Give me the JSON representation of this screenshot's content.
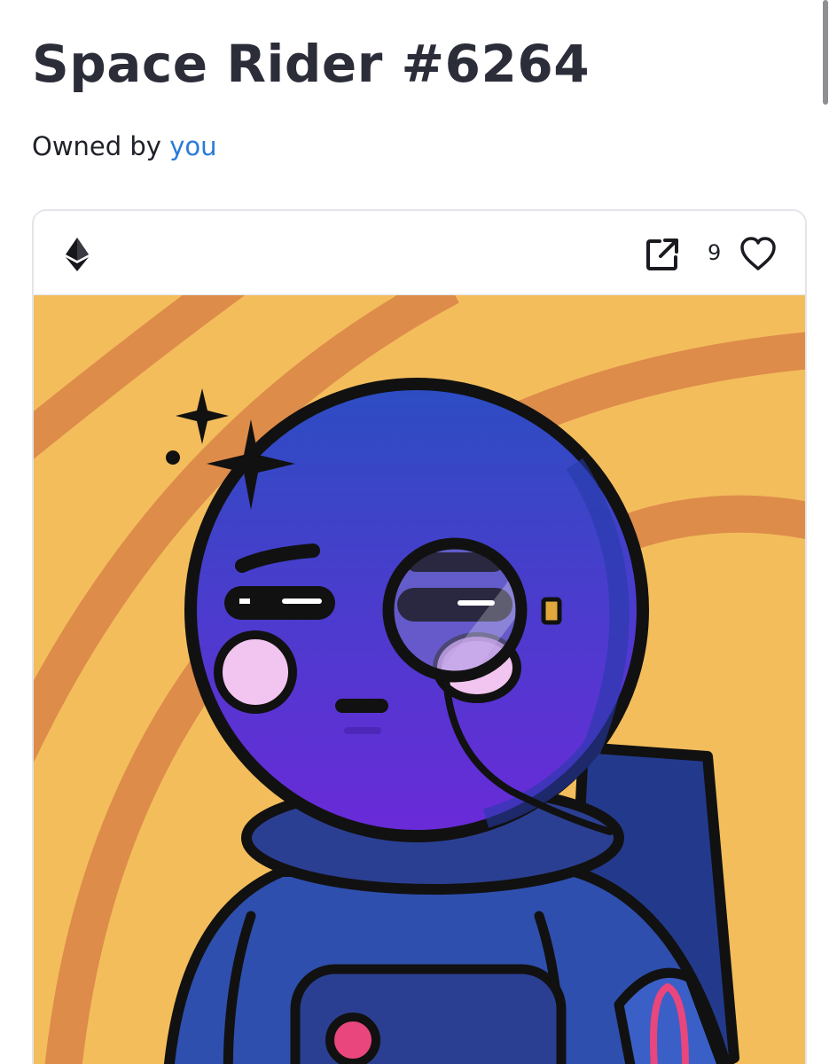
{
  "item": {
    "title": "Space Rider #6264",
    "owned_by_label": "Owned by",
    "owner": "you"
  },
  "card": {
    "chain_icon": "ethereum-icon",
    "external_link_icon": "external-link-icon",
    "favorites_count": "9",
    "favorite_icon": "heart-outline-icon"
  },
  "artwork": {
    "description_icon": "astronaut-nft-image"
  },
  "colors": {
    "title": "#2b2d38",
    "link": "#2a7bd6",
    "art_background": "#f3bd5c",
    "art_stripes": "#de8c4a",
    "helmet": "#3b3fc4",
    "suit": "#2f4fae",
    "cheek": "#f2c4f0",
    "button": "#e8467c"
  }
}
